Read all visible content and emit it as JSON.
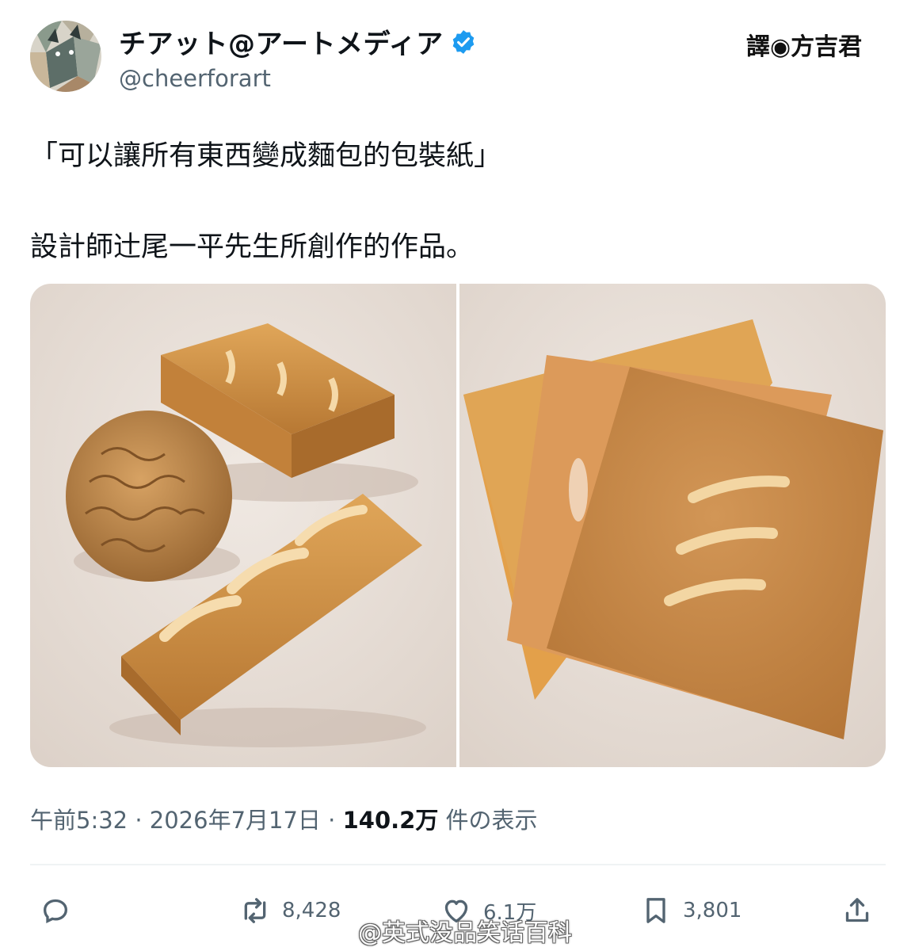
{
  "author": {
    "display_name": "チアット@アートメディア",
    "handle": "@cheerforart",
    "verified": true,
    "avatar_icon": "cubist-cat-avatar"
  },
  "translator_badge": "譯◉方吉君",
  "tweet": {
    "line1": "「可以讓所有東西變成麵包的包裝紙」",
    "line2": "設計師辻尾一平先生所創作的作品。"
  },
  "media": [
    {
      "name": "wrapped-items-photo",
      "icon": "bread-wrapped-objects"
    },
    {
      "name": "wrapping-sheets-photo",
      "icon": "bread-paper-sheets"
    }
  ],
  "meta": {
    "time": "午前5:32",
    "sep1": " · ",
    "date": "2026年7月17日",
    "sep2": " · ",
    "views": "140.2万",
    "views_label": " 件の表示"
  },
  "actions": {
    "reply": {
      "icon": "reply-icon",
      "count": ""
    },
    "repost": {
      "icon": "repost-icon",
      "count": "8,428"
    },
    "like": {
      "icon": "heart-icon",
      "count": "6.1万"
    },
    "bookmark": {
      "icon": "bookmark-icon",
      "count": "3,801"
    },
    "share": {
      "icon": "share-icon",
      "count": ""
    }
  },
  "watermark": "@英式没品笑话百科",
  "colors": {
    "text_primary": "#0f1419",
    "text_secondary": "#536471",
    "verified_blue": "#1d9bf0",
    "divider": "#eff3f4",
    "photo_background": "#ebe3dd",
    "bread_crust": "#c98a3f"
  }
}
